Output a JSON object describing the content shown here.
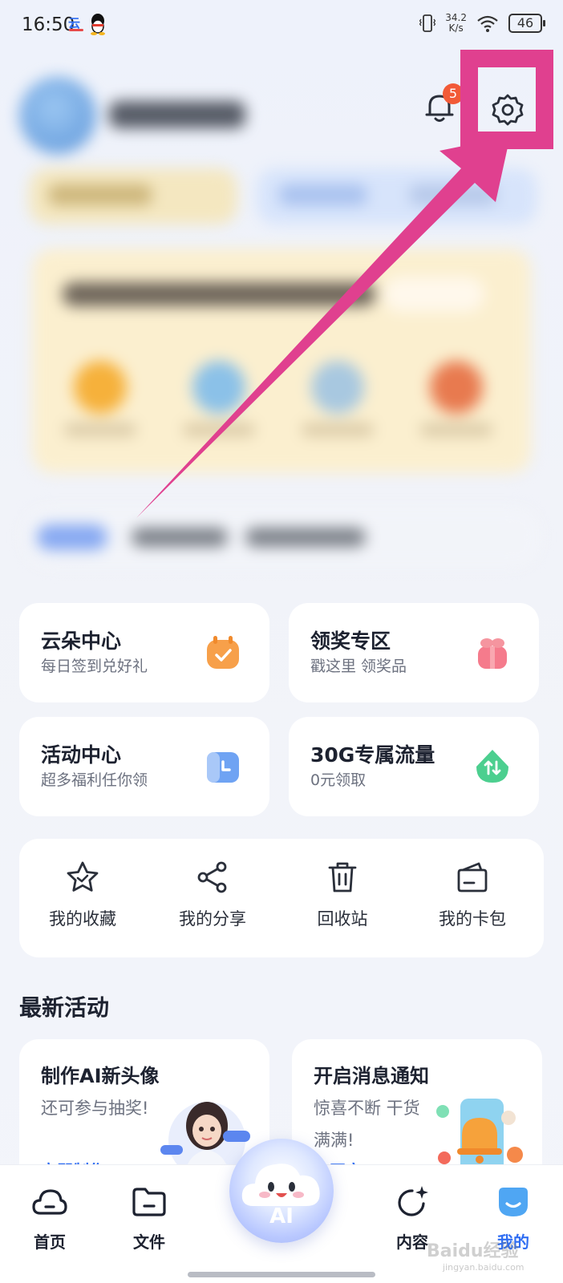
{
  "status_bar": {
    "time": "16:50",
    "speed_value": "34.2",
    "speed_unit": "K/s",
    "battery": "46"
  },
  "header": {
    "notification_count": "5"
  },
  "feature_cards": [
    {
      "title": "云朵中心",
      "subtitle": "每日签到兑好礼",
      "icon": "calendar-check-icon",
      "color": "#f7a04a"
    },
    {
      "title": "领奖专区",
      "subtitle": "戳这里 领奖品",
      "icon": "gift-icon",
      "color": "#f57b8c"
    },
    {
      "title": "活动中心",
      "subtitle": "超多福利任你领",
      "icon": "clock-calendar-icon",
      "color": "#6fa3f3"
    },
    {
      "title": "30G专属流量",
      "subtitle": "0元领取",
      "icon": "data-transfer-icon",
      "color": "#4ccf8f"
    }
  ],
  "tools": [
    {
      "label": "我的收藏",
      "icon": "star-icon"
    },
    {
      "label": "我的分享",
      "icon": "share-icon"
    },
    {
      "label": "回收站",
      "icon": "trash-icon"
    },
    {
      "label": "我的卡包",
      "icon": "card-wallet-icon"
    }
  ],
  "section": {
    "title": "最新活动"
  },
  "promos": [
    {
      "title": "制作AI新头像",
      "subtitle": "还可参与抽奖!",
      "link": "立即制作"
    },
    {
      "title": "开启消息通知",
      "subtitle": "惊喜不断 干货满满!",
      "link": "去开启"
    }
  ],
  "bottom_nav": {
    "items": [
      {
        "label": "首页",
        "icon": "cloud-home-icon"
      },
      {
        "label": "文件",
        "icon": "folder-icon"
      },
      {
        "label": "内容",
        "icon": "refresh-sparkle-icon"
      },
      {
        "label": "我的",
        "icon": "profile-face-icon"
      }
    ],
    "ai_label": "AI",
    "active_color": "#2f6df2"
  },
  "annotation_color": "#e0408f",
  "watermark": {
    "text": "Baidu经验",
    "url": "jingyan.baidu.com"
  }
}
